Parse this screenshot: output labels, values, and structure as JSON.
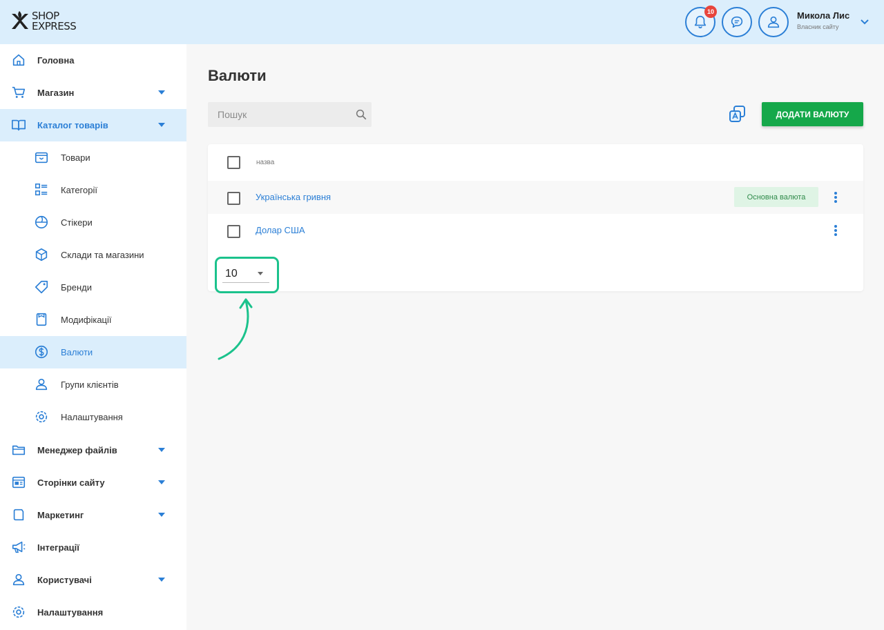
{
  "header": {
    "logo_line1": "SHOP",
    "logo_line2": "EXPRESS",
    "notifications_count": "10",
    "user_name": "Микола Лис",
    "user_role": "Власник сайту"
  },
  "sidebar": {
    "items": [
      {
        "label": "Головна",
        "icon": "home-icon"
      },
      {
        "label": "Магазин",
        "icon": "cart-icon",
        "expandable": true
      },
      {
        "label": "Каталог товарів",
        "icon": "catalog-icon",
        "expandable": true,
        "active": true
      },
      {
        "label": "Менеджер файлів",
        "icon": "folder-icon",
        "expandable": true
      },
      {
        "label": "Сторінки сайту",
        "icon": "pages-icon",
        "expandable": true
      },
      {
        "label": "Маркетинг",
        "icon": "marketing-icon",
        "expandable": true
      },
      {
        "label": "Інтеграції",
        "icon": "megaphone-icon"
      },
      {
        "label": "Користувачі",
        "icon": "users-icon",
        "expandable": true
      },
      {
        "label": "Налаштування",
        "icon": "settings-icon"
      }
    ],
    "catalog_sub": [
      {
        "label": "Товари",
        "icon": "product-box-icon"
      },
      {
        "label": "Категорії",
        "icon": "categories-icon"
      },
      {
        "label": "Стікери",
        "icon": "sticker-icon"
      },
      {
        "label": "Склади та магазини",
        "icon": "warehouse-icon"
      },
      {
        "label": "Бренди",
        "icon": "tag-icon"
      },
      {
        "label": "Модифікації",
        "icon": "modification-icon"
      },
      {
        "label": "Валюти",
        "icon": "currency-icon",
        "active": true
      },
      {
        "label": "Групи клієнтів",
        "icon": "client-group-icon"
      },
      {
        "label": "Налаштування",
        "icon": "settings-icon"
      }
    ]
  },
  "main": {
    "title": "Валюти",
    "search_placeholder": "Пошук",
    "add_button": "ДОДАТИ ВАЛЮТУ",
    "column_name": "назва",
    "rows": [
      {
        "name": "Українська гривня",
        "badge": "Основна валюта"
      },
      {
        "name": "Долар США",
        "badge": ""
      }
    ],
    "per_page": "10"
  },
  "colors": {
    "accent": "#2b7fd6",
    "header_bg": "#dbeefc",
    "primary_button": "#15a84a",
    "highlight": "#1bc28c"
  }
}
